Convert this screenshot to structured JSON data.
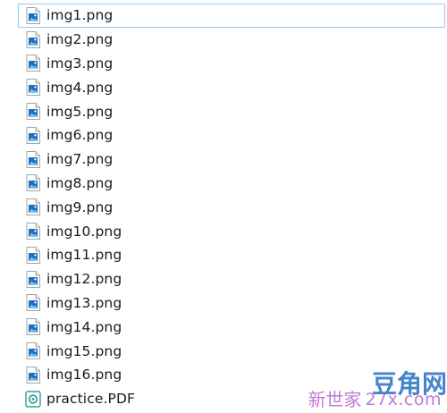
{
  "files": [
    {
      "name": "img1.png",
      "icon": "image-file-icon",
      "focused": true
    },
    {
      "name": "img2.png",
      "icon": "image-file-icon"
    },
    {
      "name": "img3.png",
      "icon": "image-file-icon"
    },
    {
      "name": "img4.png",
      "icon": "image-file-icon"
    },
    {
      "name": "img5.png",
      "icon": "image-file-icon"
    },
    {
      "name": "img6.png",
      "icon": "image-file-icon"
    },
    {
      "name": "img7.png",
      "icon": "image-file-icon"
    },
    {
      "name": "img8.png",
      "icon": "image-file-icon"
    },
    {
      "name": "img9.png",
      "icon": "image-file-icon"
    },
    {
      "name": "img10.png",
      "icon": "image-file-icon"
    },
    {
      "name": "img11.png",
      "icon": "image-file-icon"
    },
    {
      "name": "img12.png",
      "icon": "image-file-icon"
    },
    {
      "name": "img13.png",
      "icon": "image-file-icon"
    },
    {
      "name": "img14.png",
      "icon": "image-file-icon"
    },
    {
      "name": "img15.png",
      "icon": "image-file-icon"
    },
    {
      "name": "img16.png",
      "icon": "image-file-icon"
    },
    {
      "name": "practice.PDF",
      "icon": "pdf-file-icon"
    }
  ],
  "watermark": {
    "logo_text": "豆角网",
    "site_text": "新世家",
    "url_text": "27x.com"
  },
  "colors": {
    "focus_outline": "#99c9ef",
    "image_icon_blue": "#1e6fc0",
    "pdf_icon_teal": "#3aa39a",
    "watermark_purple": "#c07bd6",
    "watermark_blue": "#3d7fc9"
  }
}
